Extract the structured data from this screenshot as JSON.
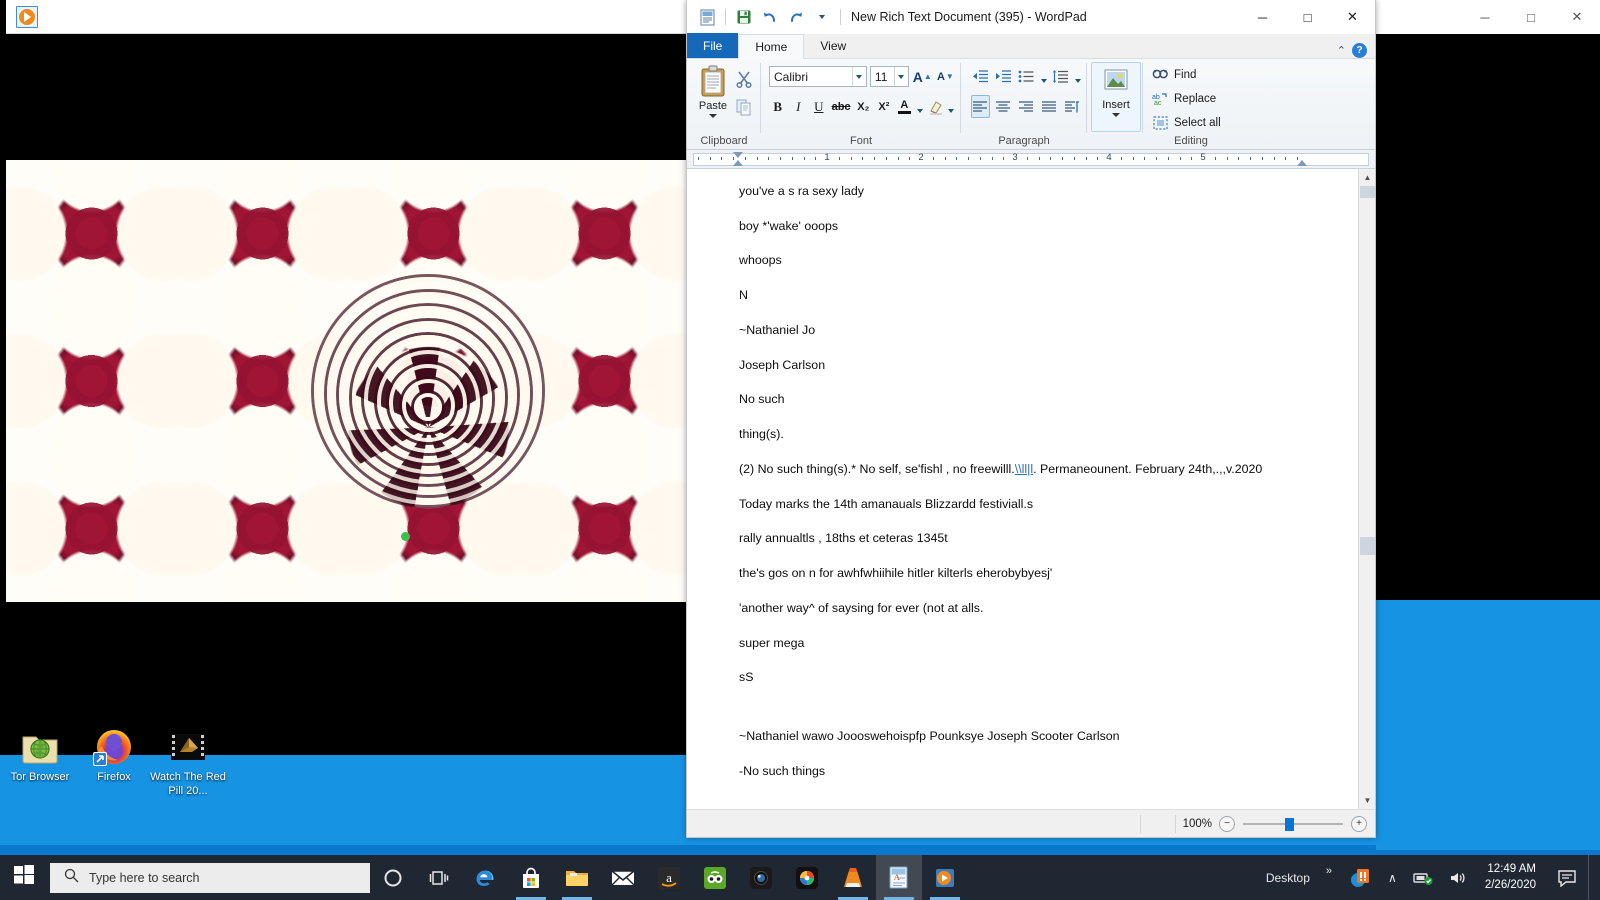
{
  "wordpad": {
    "title": "New Rich Text Document (395) - WordPad",
    "quick_access": [
      "document-icon",
      "save-icon",
      "undo-icon",
      "redo-icon",
      "customize-qat-caret"
    ],
    "window_buttons": {
      "minimize": "─",
      "maximize": "□",
      "close": "✕"
    },
    "tabs": [
      {
        "label": "File",
        "id": "file"
      },
      {
        "label": "Home",
        "id": "home"
      },
      {
        "label": "View",
        "id": "view"
      }
    ],
    "ribbon_collapse": "⌃",
    "help_label": "?",
    "groups": {
      "clipboard": {
        "label": "Clipboard",
        "paste": "Paste",
        "cut": "cut-icon",
        "copy": "copy-icon"
      },
      "font": {
        "label": "Font",
        "family": "Calibri",
        "size": "11",
        "grow": "A",
        "shrink": "A",
        "bold": "B",
        "italic": "I",
        "underline": "U",
        "strikethrough": "abc",
        "subscript": "X₂",
        "superscript": "X²",
        "text_color": "A",
        "highlight": "highlight-icon"
      },
      "paragraph": {
        "label": "Paragraph",
        "decrease_indent": "decrease-indent-icon",
        "increase_indent": "increase-indent-icon",
        "bullets": "bullets-icon",
        "line_spacing": "line-spacing-icon",
        "align_left": "align-left-icon",
        "align_center": "align-center-icon",
        "align_right": "align-right-icon",
        "justify": "justify-icon",
        "paragraph_settings": "paragraph-settings-icon"
      },
      "insert": {
        "label": "Insert",
        "button": "Insert"
      },
      "editing": {
        "label": "Editing",
        "find": "Find",
        "replace": "Replace",
        "select_all": "Select all"
      }
    },
    "ruler": {
      "numbers": [
        "1",
        "2",
        "3",
        "4",
        "5"
      ],
      "unit_max": 6
    },
    "document": {
      "paragraphs": [
        {
          "text": "you've a s ra  sexy lady"
        },
        {
          "text": "boy *'wake' ooops"
        },
        {
          "text": "whoops"
        },
        {
          "text": "N"
        },
        {
          "text": "~Nathaniel Jo"
        },
        {
          "text": "Joseph Carlson"
        },
        {
          "text": "No such"
        },
        {
          "text": "thing(s)."
        },
        {
          "pre": "(2) No such thing(s).* No self, se'fishl , no freewilll.",
          "link": "\\\\ll|l",
          "post": ". Permaneounent. February 24th,.,,v.2020"
        },
        {
          "text": "Today marks the 14th amanauals  Blizzardd festiviall.s"
        },
        {
          "text": "rally annualtls , 18ths et ceteras  1345t"
        },
        {
          "text": "the's gos on n for awhfwhiihile hitler kilterls eherobybyesj'"
        },
        {
          "text": "'another way^ of saysing for ever (not at alls."
        },
        {
          "text": "super mega"
        },
        {
          "text": "sS"
        },
        {
          "text": ""
        },
        {
          "text": "~Nathaniel wawo   Joooswehoispfp Pounksye Joseph Scooter Carlson"
        },
        {
          "text": "-No such things"
        }
      ]
    },
    "status": {
      "zoom_percent": "100%",
      "zoom_out": "−",
      "zoom_in": "+"
    }
  },
  "background_window": {
    "buttons": {
      "minimize": "─",
      "maximize": "□",
      "close": "✕"
    }
  },
  "media_window": {
    "icon": "media-player-icon"
  },
  "desktop": {
    "icons": [
      {
        "label": "Tor Browser",
        "icon": "tor-browser-icon"
      },
      {
        "label": "Firefox",
        "icon": "firefox-icon"
      },
      {
        "label": "Watch The Red Pill 20...",
        "icon": "video-file-icon"
      }
    ]
  },
  "taskbar": {
    "start": "windows-logo-icon",
    "search_placeholder": "Type here to search",
    "search_icon": "search-icon",
    "apps": [
      {
        "name": "cortana-icon",
        "active": false,
        "running": false
      },
      {
        "name": "task-view-icon",
        "active": false,
        "running": false
      },
      {
        "name": "edge-icon",
        "active": false,
        "running": false
      },
      {
        "name": "microsoft-store-icon",
        "active": false,
        "running": true
      },
      {
        "name": "file-explorer-icon",
        "active": false,
        "running": true
      },
      {
        "name": "mail-icon",
        "active": false,
        "running": false
      },
      {
        "name": "amazon-icon",
        "active": false,
        "running": false
      },
      {
        "name": "tripadvisor-icon",
        "active": false,
        "running": false
      },
      {
        "name": "camera-app-icon",
        "active": false,
        "running": false
      },
      {
        "name": "color-orb-icon",
        "active": false,
        "running": false
      },
      {
        "name": "vlc-icon",
        "active": false,
        "running": true
      },
      {
        "name": "wordpad-icon",
        "active": true,
        "running": true
      },
      {
        "name": "media-player-icon",
        "active": false,
        "running": true
      }
    ],
    "tray": {
      "desktop_label": "Desktop",
      "overflow": "»",
      "malwarebytes": "malwarebytes-icon",
      "chevron_up": "∧",
      "network": "network-icon",
      "volume": "volume-icon",
      "time": "12:49 AM",
      "date": "2/26/2020",
      "notifications": "action-center-icon"
    }
  },
  "colors": {
    "accent_blue": "#0a74d4",
    "file_tab_blue": "#1669b8",
    "taskbar": "#1f2733",
    "desktop_blue": "#1793e3",
    "link_blue": "#2a6fc0"
  }
}
